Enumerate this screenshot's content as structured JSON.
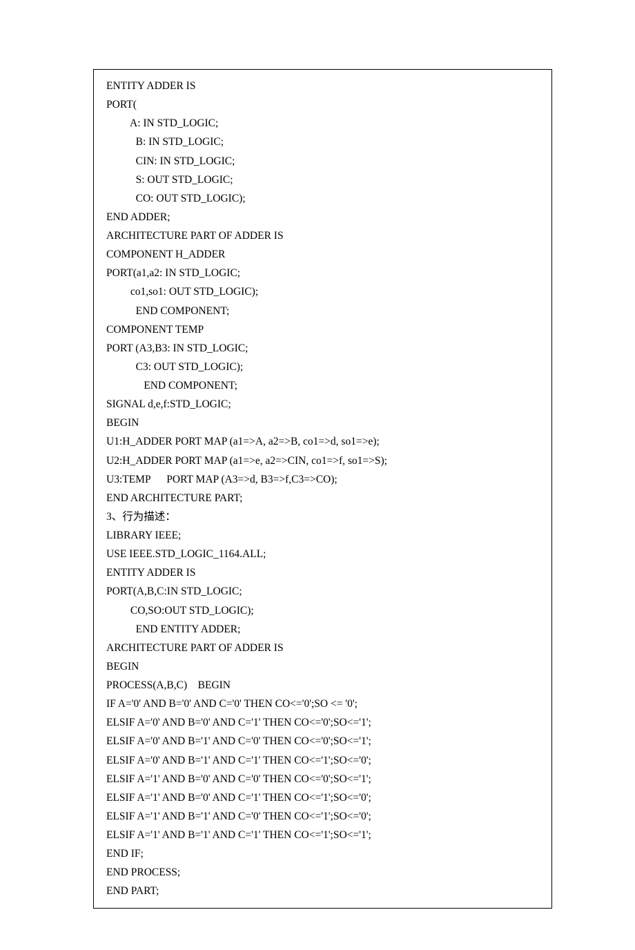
{
  "lines": [
    "ENTITY ADDER IS",
    "PORT(",
    "         A: IN STD_LOGIC;",
    "           B: IN STD_LOGIC;",
    "           CIN: IN STD_LOGIC;",
    "           S: OUT STD_LOGIC;",
    "           CO: OUT STD_LOGIC);",
    "END ADDER;",
    "ARCHITECTURE PART OF ADDER IS",
    "COMPONENT H_ADDER",
    "PORT(a1,a2: IN STD_LOGIC;",
    "         co1,so1: OUT STD_LOGIC);",
    "           END COMPONENT;",
    "COMPONENT TEMP",
    "PORT (A3,B3: IN STD_LOGIC;",
    "           C3: OUT STD_LOGIC);",
    "              END COMPONENT;",
    "SIGNAL d,e,f:STD_LOGIC;",
    "BEGIN",
    "U1:H_ADDER PORT MAP (a1=>A, a2=>B, co1=>d, so1=>e);",
    "U2:H_ADDER PORT MAP (a1=>e, a2=>CIN, co1=>f, so1=>S);",
    "U3:TEMP      PORT MAP (A3=>d, B3=>f,C3=>CO);",
    "END ARCHITECTURE PART;",
    "3、行为描述：",
    "LIBRARY IEEE;",
    "USE IEEE.STD_LOGIC_1164.ALL;",
    "ENTITY ADDER IS",
    "PORT(A,B,C:IN STD_LOGIC;",
    "         CO,SO:OUT STD_LOGIC);",
    "           END ENTITY ADDER;",
    "ARCHITECTURE PART OF ADDER IS",
    "BEGIN",
    "PROCESS(A,B,C)    BEGIN",
    "IF A='0' AND B='0' AND C='0' THEN CO<='0';SO <= '0';",
    "ELSIF A='0' AND B='0' AND C='1' THEN CO<='0';SO<='1';",
    "ELSIF A='0' AND B='1' AND C='0' THEN CO<='0';SO<='1';",
    "ELSIF A='0' AND B='1' AND C='1' THEN CO<='1';SO<='0';",
    "ELSIF A='1' AND B='0' AND C='0' THEN CO<='0';SO<='1';",
    "ELSIF A='1' AND B='0' AND C='1' THEN CO<='1';SO<='0';",
    "ELSIF A='1' AND B='1' AND C='0' THEN CO<='1';SO<='0';",
    "ELSIF A='1' AND B='1' AND C='1' THEN CO<='1';SO<='1';",
    "END IF;",
    "END PROCESS;",
    "END PART;"
  ]
}
